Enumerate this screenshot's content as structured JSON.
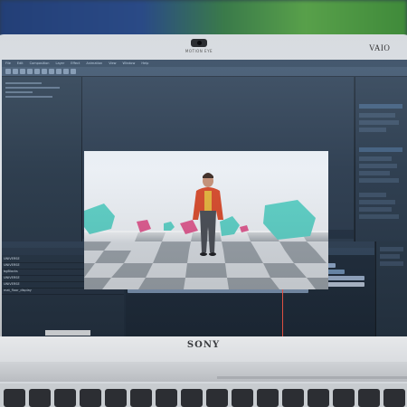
{
  "photo": {
    "subject": "Laptop screen showing a video compositing application",
    "brand_text": "SONY",
    "bezel_logo": "VAIO"
  },
  "app": {
    "menu_items": [
      "File",
      "Edit",
      "Composition",
      "Layer",
      "Effect",
      "Animation",
      "View",
      "Window",
      "Help"
    ],
    "layers": [
      {
        "name": "UNIVERSE"
      },
      {
        "name": "UNIVERSE"
      },
      {
        "name": "bgBlocks"
      },
      {
        "name": "UNIVERSE"
      },
      {
        "name": "UNIVERSE"
      },
      {
        "name": "mat_floor_display"
      }
    ]
  },
  "colors": {
    "screen_bg": "#1f2a36",
    "accent_playhead": "#ff5a4a",
    "cube_teal": "#5ed1c6",
    "cube_pink": "#e05a8f",
    "jacket_red": "#d84a2a"
  }
}
